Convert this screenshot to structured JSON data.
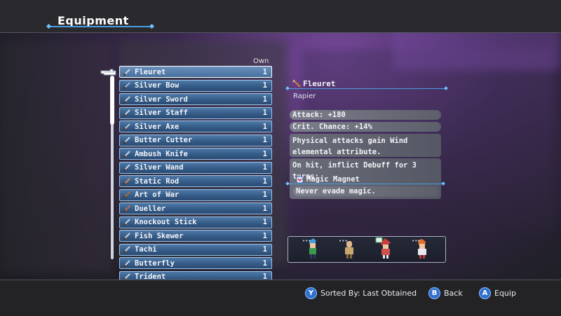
{
  "header": {
    "title": "Equipment"
  },
  "list": {
    "own_label": "Own",
    "selected_index": 0,
    "items": [
      {
        "name": "Fleuret",
        "count": "1",
        "icon": "rapier-icon",
        "color": "#c9d2dc"
      },
      {
        "name": "Silver Bow",
        "count": "1",
        "icon": "bow-icon",
        "color": "#9fb3c8"
      },
      {
        "name": "Silver Sword",
        "count": "1",
        "icon": "sword-icon",
        "color": "#c9d2dc"
      },
      {
        "name": "Silver Staff",
        "count": "1",
        "icon": "staff-icon",
        "color": "#c9d2dc"
      },
      {
        "name": "Silver Axe",
        "count": "1",
        "icon": "axe-icon",
        "color": "#b8c2cc"
      },
      {
        "name": "Butter Cutter",
        "count": "1",
        "icon": "dagger-icon",
        "color": "#c9d2dc"
      },
      {
        "name": "Ambush Knife",
        "count": "1",
        "icon": "knife-icon",
        "color": "#c9d2dc"
      },
      {
        "name": "Silver Wand",
        "count": "1",
        "icon": "wand-icon",
        "color": "#c9d2dc"
      },
      {
        "name": "Static Rod",
        "count": "1",
        "icon": "rod-icon",
        "color": "#d08a5a"
      },
      {
        "name": "Art of War",
        "count": "1",
        "icon": "book-icon",
        "color": "#b06a3a"
      },
      {
        "name": "Dueller",
        "count": "1",
        "icon": "rapier-icon",
        "color": "#c07050"
      },
      {
        "name": "Knockout Stick",
        "count": "1",
        "icon": "club-icon",
        "color": "#c9d2dc"
      },
      {
        "name": "Fish Skewer",
        "count": "1",
        "icon": "skewer-icon",
        "color": "#c9d2dc"
      },
      {
        "name": "Tachi",
        "count": "1",
        "icon": "katana-icon",
        "color": "#c9d2dc"
      },
      {
        "name": "Butterfly",
        "count": "1",
        "icon": "knife-icon",
        "color": "#c9d2dc"
      },
      {
        "name": "Trident",
        "count": "1",
        "icon": "trident-icon",
        "color": "#c9d2dc"
      }
    ]
  },
  "detail": {
    "name": "Fleuret",
    "type": "Rapier",
    "attack": "Attack:  +180",
    "crit": "Crit. Chance:  +14%",
    "effect": "Physical attacks gain Wind elemental attribute.",
    "on_hit": "On hit, inflict Debuff for 3 turns:",
    "debuff_name": "Magic Magnet",
    "debuff_desc": "Never evade magic."
  },
  "party": {
    "members": [
      "ranger",
      "monk",
      "mage",
      "fighter"
    ],
    "compare": [
      "•••",
      "•••",
      "•••",
      "•••"
    ]
  },
  "footer": {
    "sort_button": "Y",
    "sort_label": "Sorted By: Last Obtained",
    "back_button": "B",
    "back_label": "Back",
    "equip_button": "A",
    "equip_label": "Equip"
  },
  "colors": {
    "accent": "#4a9ee0",
    "row": "#355c88",
    "button": "#2f6fd0"
  }
}
